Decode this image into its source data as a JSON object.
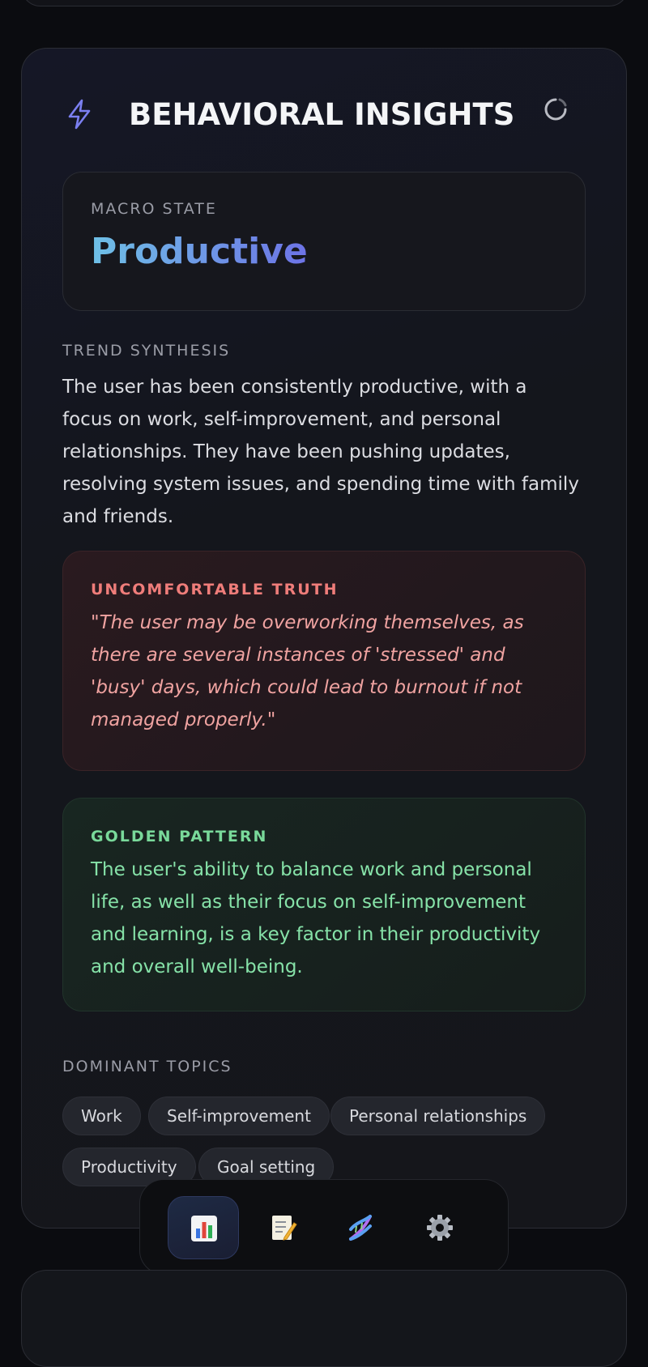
{
  "insights": {
    "title": "BEHAVIORAL INSIGHTS",
    "macro_state": {
      "label": "MACRO STATE",
      "value": "Productive"
    },
    "trend_synthesis": {
      "label": "TREND SYNTHESIS",
      "text": "The user has been consistently productive, with a focus on work, self-improvement, and personal relationships. They have been pushing updates, resolving system issues, and spending time with family and friends."
    },
    "uncomfortable_truth": {
      "label": "UNCOMFORTABLE TRUTH",
      "text": "\"The user may be overworking themselves, as there are several instances of 'stressed' and 'busy' days, which could lead to burnout if not managed properly.\""
    },
    "golden_pattern": {
      "label": "GOLDEN PATTERN",
      "text": "The user's ability to balance work and personal life, as well as their focus on self-improvement and learning, is a key factor in their productivity and overall well-being."
    },
    "dominant_topics": {
      "label": "DOMINANT TOPICS",
      "items": [
        "Work",
        "Self-improvement",
        "Personal relationships",
        "Productivity",
        "Goal setting"
      ]
    }
  },
  "nav": {
    "items": [
      {
        "icon": "bar-chart-icon",
        "active": true
      },
      {
        "icon": "memo-icon",
        "active": false
      },
      {
        "icon": "dna-icon",
        "active": false
      },
      {
        "icon": "gear-icon",
        "active": false
      }
    ]
  },
  "colors": {
    "accent_blue": "#6ec0e6",
    "accent_violet": "#6d73e6",
    "truth_red": "#ef7d7a",
    "golden_green": "#79d99a"
  }
}
